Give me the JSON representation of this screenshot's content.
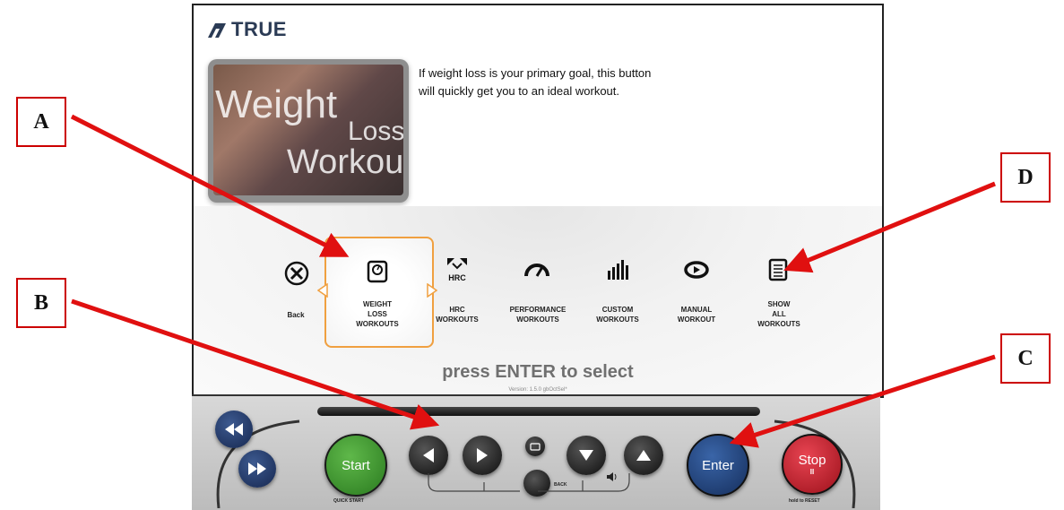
{
  "brand": {
    "name": "TRUE"
  },
  "hero": {
    "line1": "Weight",
    "line2": "Loss",
    "line3": "Workout"
  },
  "description": "If weight loss is your primary goal, this button will quickly get you to an ideal workout.",
  "menu": {
    "back": "Back",
    "weight_loss": [
      "WEIGHT",
      "LOSS",
      "WORKOUTS"
    ],
    "hrc": [
      "HRC",
      "WORKOUTS"
    ],
    "hrc_icon_text": "HRC",
    "performance": [
      "PERFORMANCE",
      "WORKOUTS"
    ],
    "custom": [
      "CUSTOM",
      "WORKOUTS"
    ],
    "manual": [
      "MANUAL",
      "WORKOUT"
    ],
    "show_all": [
      "SHOW",
      "ALL",
      "WORKOUTS"
    ]
  },
  "prompt": "press ENTER to select",
  "version": "Version: 1.5.0 gbOctSel*",
  "console": {
    "start": "Start",
    "quick_start": "QUICK START",
    "enter": "Enter",
    "stop": "Stop",
    "stop_sub": "II",
    "hold_reset": "hold to RESET",
    "back": "BACK"
  },
  "callouts": {
    "a": "A",
    "b": "B",
    "c": "C",
    "d": "D"
  },
  "colors": {
    "accent_orange": "#f0a040",
    "start_green": "#3f9a2e",
    "enter_blue": "#1d3f7a",
    "stop_red": "#c81e2a",
    "arrow_red": "#e01010"
  }
}
